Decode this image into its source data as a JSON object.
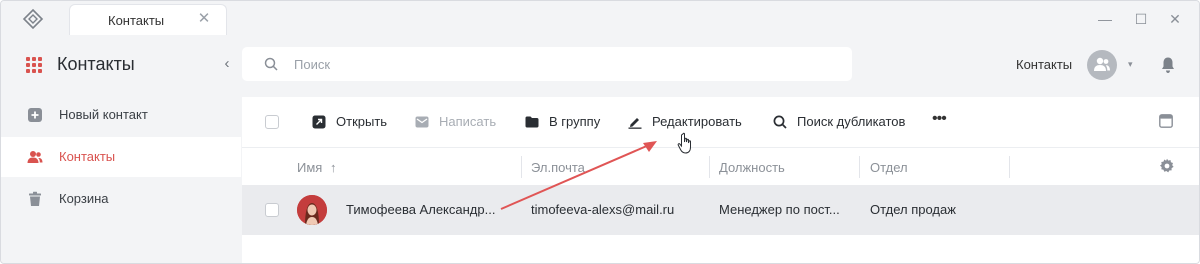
{
  "window": {
    "tab_title": "Контакты",
    "close_glyph": "✕",
    "minimize_glyph": "—",
    "maximize_glyph": "☐",
    "close_window_glyph": "✕"
  },
  "sidebar": {
    "title": "Контакты",
    "collapse_glyph": "‹",
    "items": [
      {
        "label": "Новый контакт",
        "icon": "plus-square-icon",
        "active": false
      },
      {
        "label": "Контакты",
        "icon": "users-icon",
        "active": true
      },
      {
        "label": "Корзина",
        "icon": "trash-icon",
        "active": false
      }
    ]
  },
  "header": {
    "search_placeholder": "Поиск",
    "context_label": "Контакты",
    "avatar_caret": "▾"
  },
  "toolbar": {
    "buttons": [
      {
        "label": "Открыть",
        "icon": "open-external-icon",
        "enabled": true
      },
      {
        "label": "Написать",
        "icon": "mail-icon",
        "enabled": false
      },
      {
        "label": "В группу",
        "icon": "folder-icon",
        "enabled": true
      },
      {
        "label": "Редактировать",
        "icon": "pencil-icon",
        "enabled": true
      },
      {
        "label": "Поиск дубликатов",
        "icon": "search-icon",
        "enabled": true
      }
    ],
    "more_glyph": "•••"
  },
  "table": {
    "columns": [
      "Имя",
      "Эл.почта",
      "Должность",
      "Отдел"
    ],
    "sort_glyph": "↑",
    "rows": [
      {
        "name": "Тимофеева Александр...",
        "email": "timofeeva-alexs@mail.ru",
        "position": "Менеджер по пост...",
        "department": "Отдел продаж"
      }
    ]
  },
  "colors": {
    "accent": "#d9534f",
    "annotation_arrow": "#e05555",
    "selected_row": "#eaebee",
    "background": "#f3f4f6"
  }
}
